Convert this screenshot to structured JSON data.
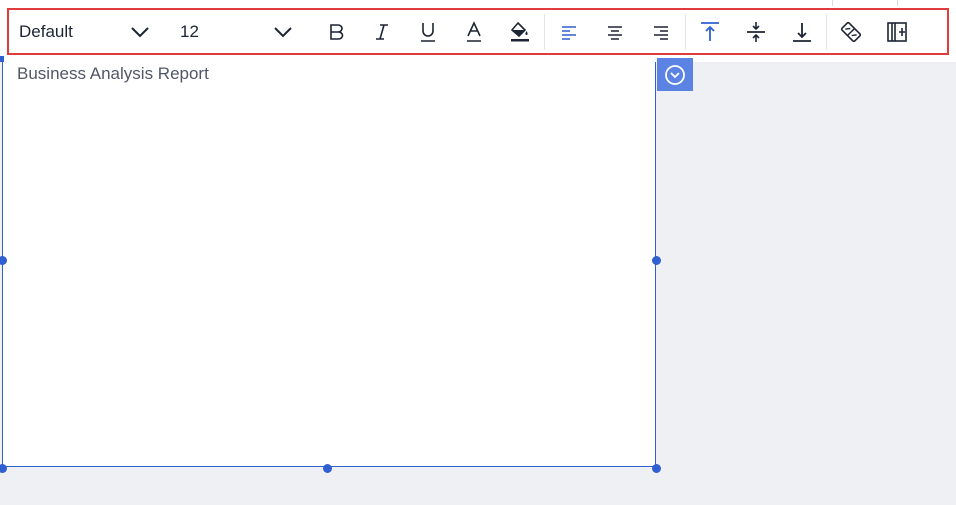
{
  "toolbar": {
    "font_family": "Default",
    "font_size": "12",
    "icons": {
      "font_dropdown": "chevron-down-icon",
      "size_dropdown": "chevron-down-icon",
      "bold": "bold-icon",
      "italic": "italic-icon",
      "underline": "underline-icon",
      "font_color": "font-color-icon",
      "fill_color": "fill-color-icon",
      "align_left": "align-left-icon",
      "align_center": "align-center-icon",
      "align_right": "align-right-icon",
      "valign_top": "vertical-align-top-icon",
      "valign_middle": "vertical-align-middle-icon",
      "valign_bottom": "vertical-align-bottom-icon",
      "clear_format": "eraser-icon",
      "insert_column": "insert-column-icon"
    },
    "highlight_color": "#e23b3b",
    "accent_color": "#2f5fd0"
  },
  "textbox": {
    "text": "Business Analysis Report",
    "collapse_icon": "chevron-down-circle-icon"
  }
}
